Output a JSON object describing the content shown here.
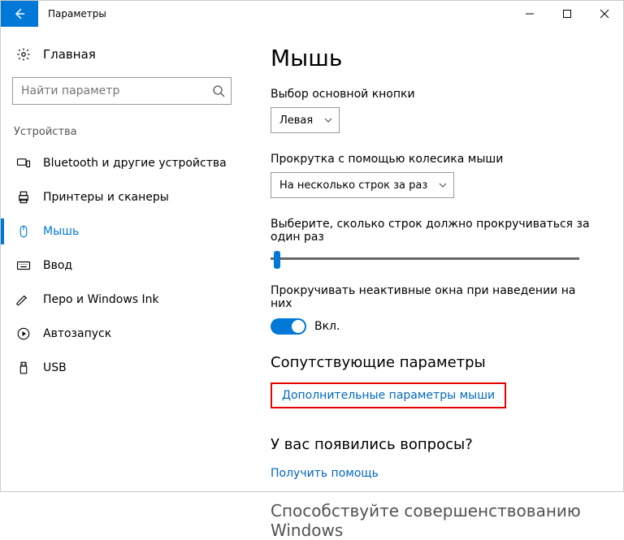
{
  "titlebar": {
    "title": "Параметры"
  },
  "sidebar": {
    "home_label": "Главная",
    "search_placeholder": "Найти параметр",
    "category_label": "Устройства",
    "items": [
      {
        "label": "Bluetooth и другие устройства"
      },
      {
        "label": "Принтеры и сканеры"
      },
      {
        "label": "Мышь"
      },
      {
        "label": "Ввод"
      },
      {
        "label": "Перо и Windows Ink"
      },
      {
        "label": "Автозапуск"
      },
      {
        "label": "USB"
      }
    ]
  },
  "main": {
    "heading": "Мышь",
    "primary_button_label": "Выбор основной кнопки",
    "primary_button_value": "Левая",
    "scroll_mode_label": "Прокрутка с помощью колесика мыши",
    "scroll_mode_value": "На несколько строк за раз",
    "lines_label": "Выберите, сколько строк должно прокручиваться за один раз",
    "inactive_scroll_label": "Прокручивать неактивные окна при наведении на них",
    "inactive_scroll_state": "Вкл.",
    "related_heading": "Сопутствующие параметры",
    "related_link": "Дополнительные параметры мыши",
    "question_heading": "У вас появились вопросы?",
    "help_link": "Получить помощь",
    "cutoff_text": "Способствуйте совершенствованию Windows"
  }
}
